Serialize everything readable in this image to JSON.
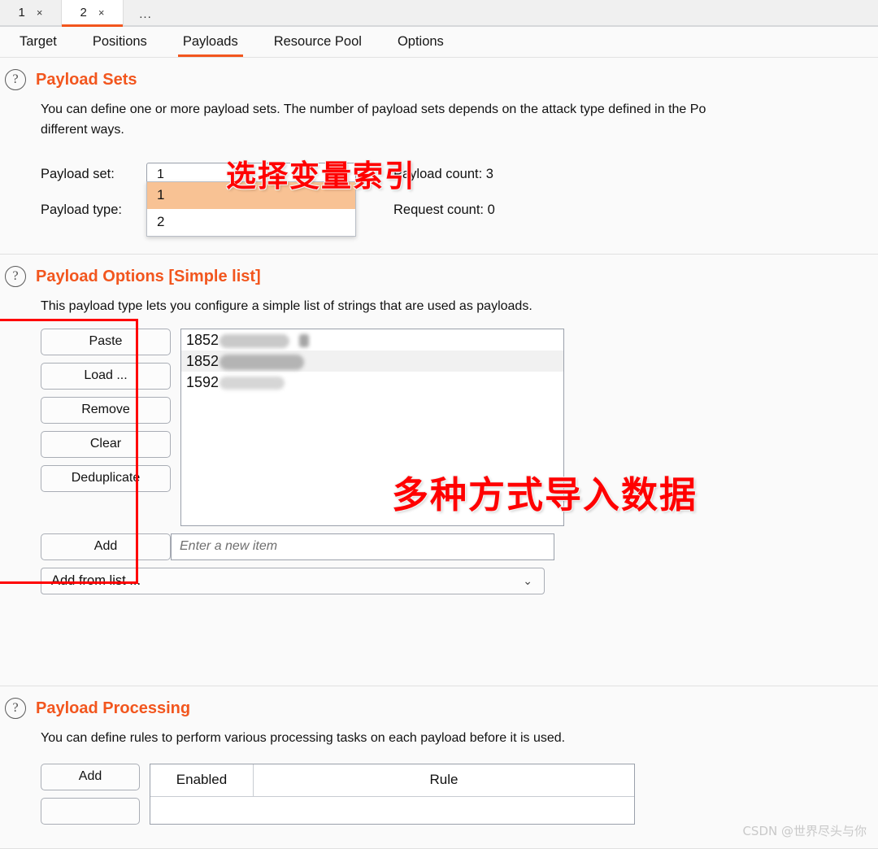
{
  "attack_tabs": {
    "items": [
      {
        "label": "1",
        "close": "×",
        "active": false
      },
      {
        "label": "2",
        "close": "×",
        "active": true
      }
    ],
    "more_label": "..."
  },
  "section_tabs": [
    {
      "label": "Target",
      "active": false
    },
    {
      "label": "Positions",
      "active": false
    },
    {
      "label": "Payloads",
      "active": true
    },
    {
      "label": "Resource Pool",
      "active": false
    },
    {
      "label": "Options",
      "active": false
    }
  ],
  "payload_sets": {
    "help_icon": "?",
    "title": "Payload Sets",
    "description_line1": "You can define one or more payload sets. The number of payload sets depends on the attack type defined in the Po",
    "description_line2": "different ways.",
    "payload_set_label": "Payload set:",
    "payload_set_value": "1",
    "payload_type_label": "Payload type:",
    "payload_count_label": "Payload count:  3",
    "request_count_label": "Request count:  0",
    "dropdown_options": [
      {
        "label": "1",
        "selected": true
      },
      {
        "label": "2",
        "selected": false
      }
    ],
    "chevron": "⌄"
  },
  "payload_options": {
    "help_icon": "?",
    "title": "Payload Options [Simple list]",
    "description": "This payload type lets you configure a simple list of strings that are used as payloads.",
    "buttons": [
      {
        "label": "Paste"
      },
      {
        "label": "Load ..."
      },
      {
        "label": "Remove"
      },
      {
        "label": "Clear"
      },
      {
        "label": "Deduplicate"
      }
    ],
    "add_button": "Add",
    "list_items": [
      {
        "prefix": "1852",
        "redacted": true
      },
      {
        "prefix": "1852",
        "redacted": true
      },
      {
        "prefix": "1592",
        "redacted": true
      }
    ],
    "new_item_placeholder": "Enter a new item",
    "add_from_list_label": "Add from list ...",
    "chevron": "⌄"
  },
  "payload_processing": {
    "help_icon": "?",
    "title": "Payload Processing",
    "description": "You can define rules to perform various processing tasks on each payload before it is used.",
    "add_button": "Add",
    "columns": [
      {
        "label": "Enabled"
      },
      {
        "label": "Rule"
      }
    ]
  },
  "annotations": [
    {
      "id": "ann1",
      "text": "选择变量索引"
    },
    {
      "id": "ann2",
      "text": "多种方式导入数据"
    }
  ],
  "watermark": "CSDN @世界尽头与你",
  "colors": {
    "accent_orange": "#f2561e",
    "dropdown_selected": "#f8c294",
    "annotation_red": "#ff0000",
    "highlight_box": "#ff0000"
  }
}
